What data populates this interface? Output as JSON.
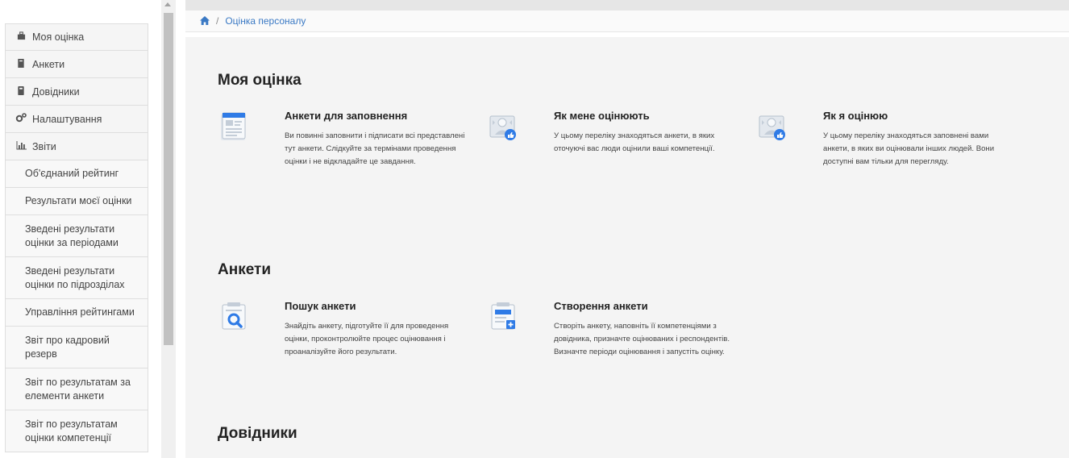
{
  "sidebar": {
    "menu": [
      {
        "label": "Моя оцінка",
        "icon": "briefcase-icon"
      },
      {
        "label": "Анкети",
        "icon": "book-icon"
      },
      {
        "label": "Довідники",
        "icon": "bookmark-icon"
      },
      {
        "label": "Налаштування",
        "icon": "gears-icon"
      },
      {
        "label": "Звіти",
        "icon": "bar-chart-icon"
      }
    ],
    "reports": [
      "Об'єднаний рейтинг",
      "Результати моєї оцінки",
      "Зведені результати оцінки за періодами",
      "Зведені результати оцінки по підрозділах",
      "Управління рейтингами",
      "Звіт про кадровий резерв",
      "Звіт по результатам за елементи анкети",
      "Звіт по результатам оцінки компетенції"
    ]
  },
  "breadcrumb": {
    "home_icon": "home-icon",
    "separator": "/",
    "current": "Оцінка персоналу"
  },
  "sections": {
    "my_rating": {
      "title": "Моя оцінка",
      "cards": [
        {
          "title": "Анкети для заповнення",
          "desc": "Ви повинні заповнити і підписати всі представлені тут анкети. Слідкуйте за термінами проведення оцінки і не відкладайте це завдання.",
          "icon": "form-document-icon"
        },
        {
          "title": "Як мене оцінюють",
          "desc": "У цьому переліку знаходяться анкети, в яких оточуючі вас люди оцінили ваші компетенції.",
          "icon": "rated-by-others-icon"
        },
        {
          "title": "Як я оцінюю",
          "desc": "У цьому переліку знаходяться заповнені вами анкети, в яких ви оцінювали інших людей. Вони доступні вам тільки для перегляду.",
          "icon": "my-ratings-icon"
        }
      ]
    },
    "forms": {
      "title": "Анкети",
      "cards": [
        {
          "title": "Пошук анкети",
          "desc": "Знайдіть анкету, підготуйте її для проведення оцінки, проконтролюйте процес оцінювання і проаналізуйте його результати.",
          "icon": "search-form-icon"
        },
        {
          "title": "Створення анкети",
          "desc": "Створіть анкету, наповніть її компетенціями з довідника, призначте оцінюваних і респондентів. Визначте періоди оцінювання і запустіть оцінку.",
          "icon": "create-form-icon"
        }
      ]
    },
    "directories": {
      "title": "Довідники"
    }
  },
  "colors": {
    "accent": "#3a79c4",
    "icon_blue": "#2f7be6",
    "icon_gray": "#b5c0cc"
  }
}
